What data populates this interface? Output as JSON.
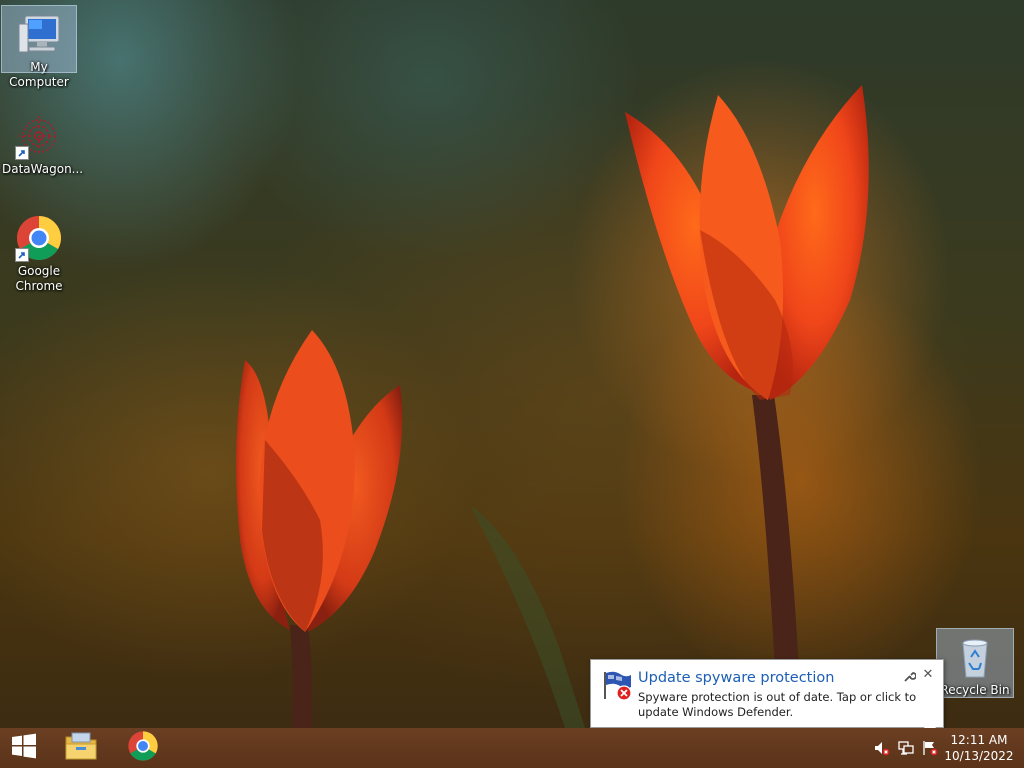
{
  "desktop": {
    "icons": [
      {
        "label": "My Computer",
        "icon": "computer-icon",
        "selected": true
      },
      {
        "label": "DataWagon...",
        "icon": "datawagon-icon",
        "shortcut": true
      },
      {
        "label": "Google Chrome",
        "icon": "chrome-icon",
        "shortcut": true
      },
      {
        "label": "Recycle Bin",
        "icon": "recycle-bin-icon",
        "selected": true
      }
    ]
  },
  "notification": {
    "title": "Update spyware protection",
    "message": "Spyware protection is out of date. Tap or click to update Windows Defender.",
    "icon": "windows-defender-flag-icon",
    "title_color": "#1c5fb4"
  },
  "taskbar": {
    "pinned": [
      {
        "name": "start-button",
        "icon": "windows-logo-icon"
      },
      {
        "name": "file-explorer",
        "icon": "folder-icon"
      },
      {
        "name": "google-chrome",
        "icon": "chrome-icon"
      }
    ],
    "tray": {
      "icons": [
        "volume-muted-icon",
        "network-icon",
        "action-center-flag-icon"
      ]
    },
    "clock": {
      "time": "12:11 AM",
      "date": "10/13/2022"
    },
    "color": "#5e361c"
  }
}
